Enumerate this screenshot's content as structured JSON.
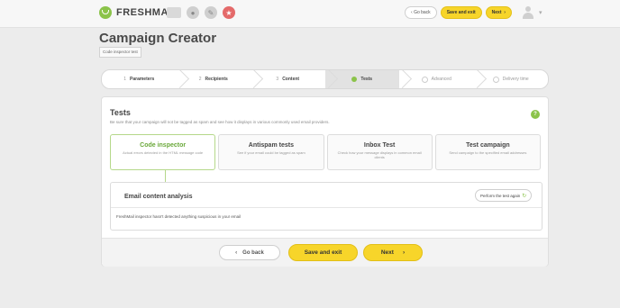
{
  "header": {
    "logo_text": "FRESHMAIL",
    "icons": [
      "mail-icon",
      "gear-icon",
      "paint-icon",
      "gift-icon"
    ],
    "go_back_label": "Go back",
    "go_back_arrow": "‹",
    "save_exit_label": "Save and exit",
    "next_label": "Next",
    "next_arrow": "›",
    "user_caret": "▾"
  },
  "page": {
    "title": "Campaign Creator",
    "subtitle": "Code inspector test"
  },
  "steps": [
    {
      "num": "1",
      "label": "Parameters"
    },
    {
      "num": "2",
      "label": "Recipients"
    },
    {
      "num": "3",
      "label": "Content"
    },
    {
      "num": "",
      "label": "Tests"
    },
    {
      "num": "",
      "label": "Advanced"
    },
    {
      "num": "",
      "label": "Delivery time"
    }
  ],
  "tests": {
    "title": "Tests",
    "description": "Be sure that your campaign will not be tagged as spam and see how it displays in various commonly used email providers.",
    "help": "?",
    "cards": [
      {
        "title": "Code inspector",
        "desc": "Actual errors detected in the HTML message code"
      },
      {
        "title": "Antispam tests",
        "desc": "See if your email could be tagged as spam"
      },
      {
        "title": "Inbox Test",
        "desc": "Check how your message displays in common email clients"
      },
      {
        "title": "Test campaign",
        "desc": "Send campaign to the specified email addresses"
      }
    ],
    "analysis": {
      "title": "Email content analysis",
      "perform_label": "Perform the test again",
      "refresh_icon": "↻",
      "result": "FreshMail inspector hasn't detected anything suspicious in your email"
    }
  },
  "footer": {
    "back_label": "Go back",
    "back_arrow": "‹",
    "save_exit_label": "Save and exit",
    "next_label": "Next",
    "next_arrow": "›"
  },
  "colors": {
    "accent_green": "#8bc34a",
    "accent_yellow": "#f7d52a",
    "background": "#ececec"
  }
}
